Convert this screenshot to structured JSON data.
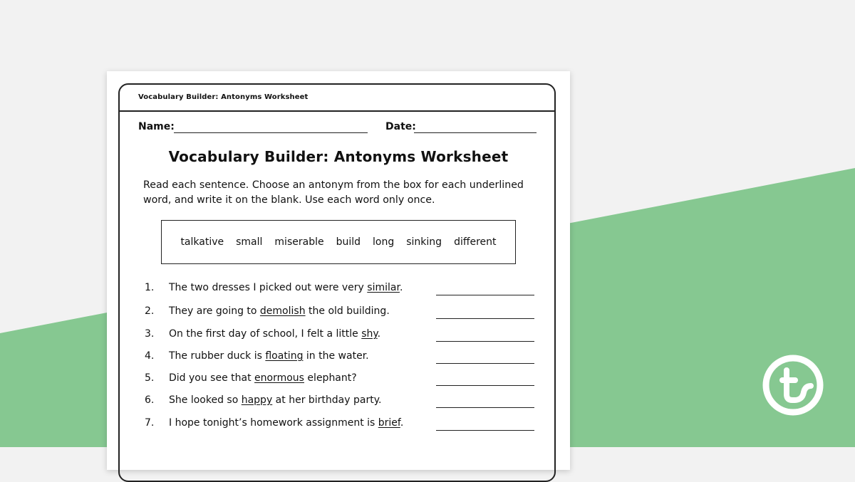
{
  "colors": {
    "background": "#f2f2f2",
    "green": "#86c891",
    "ink": "#111111"
  },
  "worksheet": {
    "header_title": "Vocabulary Builder: Antonyms Worksheet",
    "name_label": "Name:",
    "date_label": "Date:",
    "title": "Vocabulary Builder: Antonyms Worksheet",
    "instructions": "Read each sentence. Choose an antonym from the box for each underlined word, and write it on the blank. Use each word only once.",
    "word_bank": [
      "talkative",
      "small",
      "miserable",
      "build",
      "long",
      "sinking",
      "different"
    ],
    "questions": [
      {
        "num": "1.",
        "before": "The two dresses I picked out were very ",
        "word": "similar",
        "after": "."
      },
      {
        "num": "2.",
        "before": "They are going to ",
        "word": "demolish",
        "after": " the old building."
      },
      {
        "num": "3.",
        "before": "On the first day of school, I felt a little ",
        "word": "shy",
        "after": "."
      },
      {
        "num": "4.",
        "before": "The rubber duck is ",
        "word": "floating",
        "after": " in the water."
      },
      {
        "num": "5.",
        "before": "Did you see that ",
        "word": "enormous",
        "after": " elephant?"
      },
      {
        "num": "6.",
        "before": "She looked so ",
        "word": "happy",
        "after": " at her birthday party."
      },
      {
        "num": "7.",
        "before": "I hope tonight’s homework assignment is ",
        "word": "brief",
        "after": "."
      }
    ]
  },
  "brand": {
    "logo_icon": "teach-starter-logo-icon"
  }
}
